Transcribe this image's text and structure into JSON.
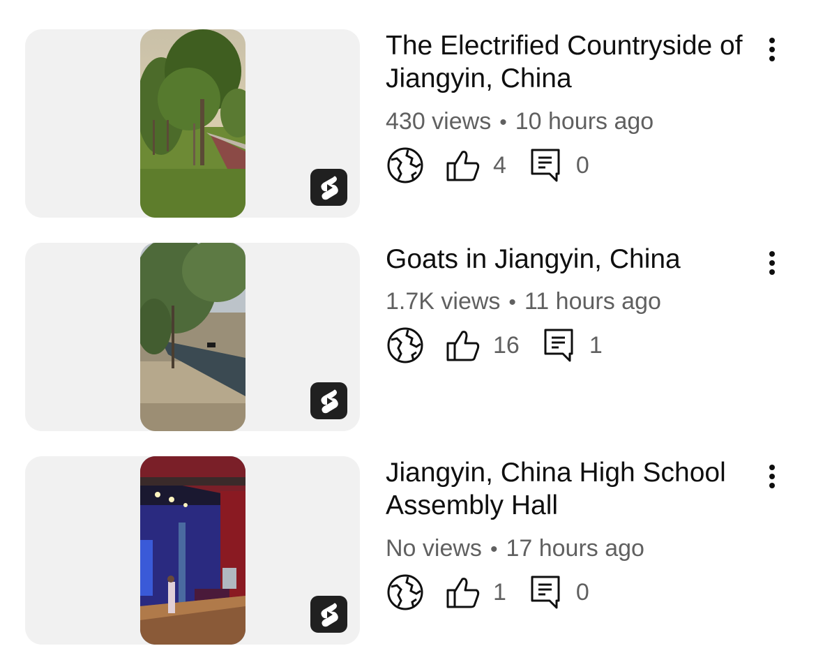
{
  "videos": [
    {
      "title": "The Electrified Countryside of Jiangyin, China",
      "views": "430 views",
      "age": "10 hours ago",
      "visibility_icon": "globe-icon",
      "likes": "4",
      "comments": "0"
    },
    {
      "title": "Goats in Jiangyin, China",
      "views": "1.7K views",
      "age": "11 hours ago",
      "visibility_icon": "globe-icon",
      "likes": "16",
      "comments": "1"
    },
    {
      "title": "Jiangyin, China High School Assembly Hall",
      "views": "No views",
      "age": "17 hours ago",
      "visibility_icon": "globe-icon",
      "likes": "1",
      "comments": "0"
    }
  ],
  "separator": "•",
  "colors": {
    "card_background": "#f1f1f1",
    "badge_background": "#202020",
    "secondary_text": "#606060",
    "primary_text": "#0f0f0f"
  }
}
